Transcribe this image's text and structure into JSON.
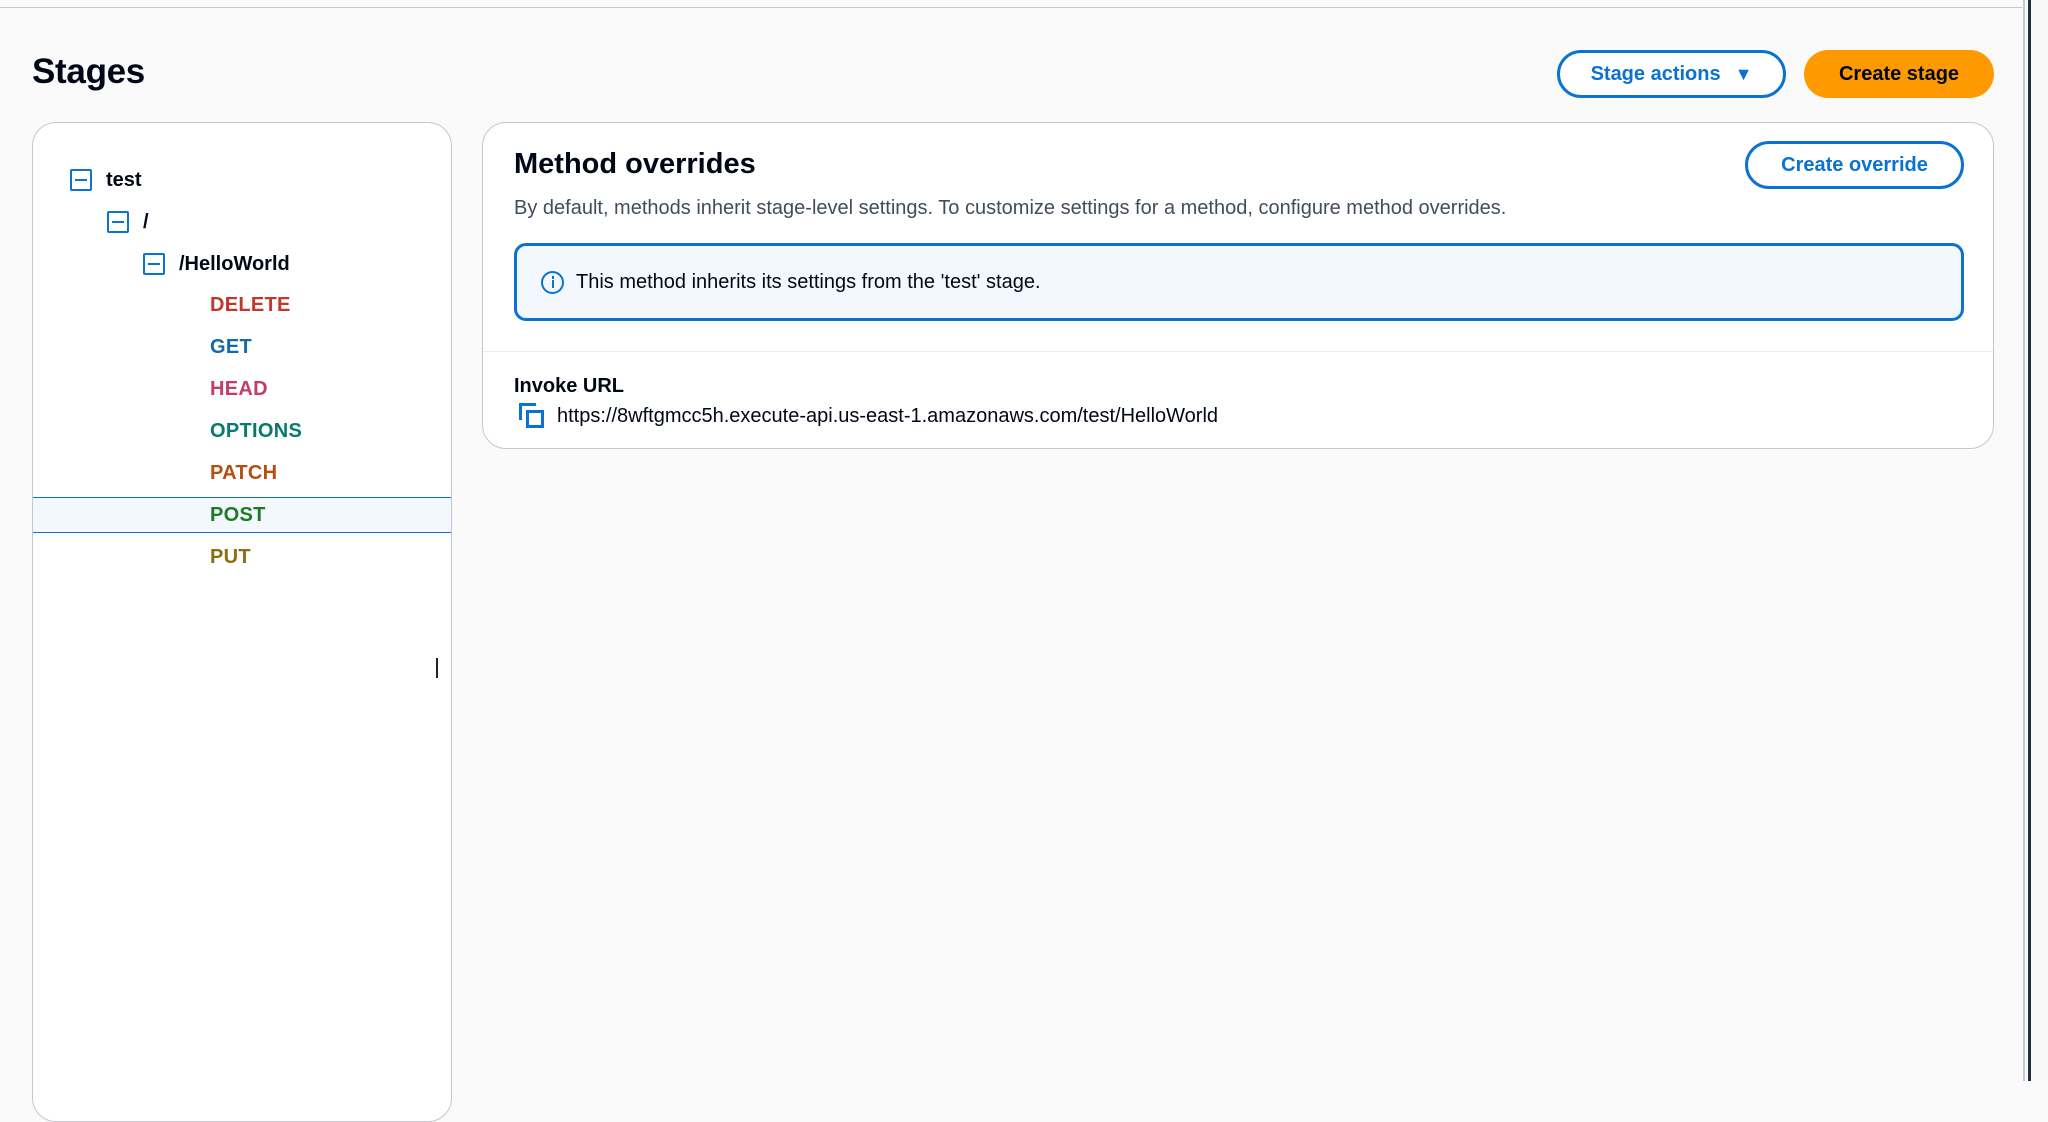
{
  "page": {
    "title": "Stages"
  },
  "toolbar": {
    "stage_actions_label": "Stage actions",
    "create_stage_label": "Create stage"
  },
  "tree": {
    "stage": "test",
    "root_resource": "/",
    "resource": "/HelloWorld",
    "methods": [
      "DELETE",
      "GET",
      "HEAD",
      "OPTIONS",
      "PATCH",
      "POST",
      "PUT"
    ],
    "selected_method": "POST"
  },
  "overrides": {
    "title": "Method overrides",
    "description": "By default, methods inherit stage-level settings. To customize settings for a method, configure method overrides.",
    "create_override_label": "Create override",
    "info_message": "This method inherits its settings from the 'test' stage.",
    "invoke_url_label": "Invoke URL",
    "invoke_url": "https://8wftgmcc5h.execute-api.us-east-1.amazonaws.com/test/HelloWorld"
  },
  "colors": {
    "accent": "#0972d3",
    "primary_button": "#ff9900",
    "method_delete": "#c0372b",
    "method_get": "#1469a8",
    "method_head": "#c33d69",
    "method_options": "#067a6f",
    "method_patch": "#b74d0f",
    "method_post": "#1f7a21",
    "method_put": "#8c6d10"
  },
  "icons": [
    "collapse-icon",
    "caret-down-icon",
    "info-icon",
    "copy-icon"
  ]
}
